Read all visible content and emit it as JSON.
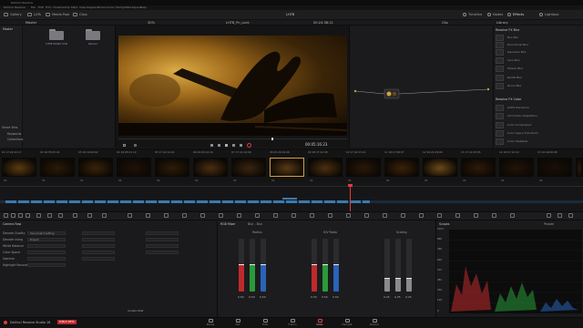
{
  "window": {
    "title": "DaVinci Resolve"
  },
  "menu": [
    "DaVinci Resolve",
    "File",
    "Edit",
    "Trim",
    "Timeline",
    "Clip",
    "Mark",
    "View",
    "Playback",
    "Fusion",
    "Color",
    "Fairlight",
    "Workspace",
    "Help"
  ],
  "toolbar": {
    "left": [
      "Gallery",
      "LUTs",
      "Media Pool",
      "Clips"
    ],
    "center": "LHTB",
    "right": [
      "Timeline",
      "Nodes",
      "Effects",
      "Lightbox"
    ]
  },
  "subbar": {
    "panel": "Master",
    "zoom": "30%",
    "clip_name": "LHTB_Pn_Lock",
    "timecode": "00:24:38:21",
    "clip_label": "Clip",
    "library": "Library"
  },
  "bins": {
    "master": "Master",
    "smart_bins": "Smart Bins",
    "items": [
      "Keywords",
      "Collections"
    ]
  },
  "media_folders": [
    "LHTB 00405 SCN",
    "Render"
  ],
  "viewer": {
    "timecode": "00:05:16:23"
  },
  "library": {
    "section1": "Resolve FX Blur",
    "items1": [
      "Box Blur",
      "Directional Blur",
      "Gaussian Blur",
      "Lens Blur",
      "Mosaic Blur",
      "Radial Blur",
      "Zoom Blur"
    ],
    "section2": "Resolve FX Color",
    "items2": [
      "ACES Transform",
      "Chromatic Adaptation",
      "Color Compressor",
      "Color Space Transform",
      "Color Stabilizer"
    ]
  },
  "clips": [
    {
      "num": "01",
      "tc": "17:22:22:17",
      "track": "V1"
    },
    {
      "num": "02",
      "tc": "16:55:05:01",
      "track": "V1"
    },
    {
      "num": "03",
      "tc": "16:19:06:02",
      "track": "V1"
    },
    {
      "num": "04",
      "tc": "19:05:01:10",
      "track": "V1"
    },
    {
      "num": "05",
      "tc": "17:41:14:01",
      "track": "V1"
    },
    {
      "num": "06",
      "tc": "20:24:22:16",
      "track": "V1"
    },
    {
      "num": "07",
      "tc": "17:41:10:06",
      "track": "V1"
    },
    {
      "num": "08",
      "tc": "20:24:29:06",
      "track": "V1"
    },
    {
      "num": "09",
      "tc": "18:37:22:08",
      "track": "V1"
    },
    {
      "num": "10",
      "tc": "17:42:13:21",
      "track": "V1"
    },
    {
      "num": "11",
      "tc": "18:17:08:07",
      "track": "V1"
    },
    {
      "num": "12",
      "tc": "20:24:29:06",
      "track": "V1"
    },
    {
      "num": "13",
      "tc": "17:11:03:05",
      "track": "V1"
    },
    {
      "num": "14",
      "tc": "18:17:12:19",
      "track": "V1"
    },
    {
      "num": "15",
      "tc": "16:49:06:08",
      "track": "V1"
    },
    {
      "num": "16",
      "tc": "20:22:23:22",
      "track": "V1"
    }
  ],
  "camera_raw": {
    "title": "Camera Raw",
    "rows": [
      {
        "label": "Decode Quality",
        "value": "Use project setting"
      },
      {
        "label": "Decode Using",
        "value": "Project"
      },
      {
        "label": "White Balance",
        "value": ""
      },
      {
        "label": "Color Space",
        "value": ""
      },
      {
        "label": "Gamma",
        "value": ""
      },
      {
        "label": "Highlight Recovery",
        "value": ""
      }
    ],
    "bottom_label": "Update RAW"
  },
  "rgb_mixer": {
    "title": "RGB Mixer",
    "mode": "Blur - Blur",
    "groups": [
      {
        "name": "Radius",
        "values": [
          "0.50",
          "0.50",
          "0.50"
        ],
        "fill": [
          0.5,
          0.5,
          0.5
        ]
      },
      {
        "name": "H/V Ratio",
        "values": [
          "0.50",
          "0.50",
          "0.50"
        ],
        "fill": [
          0.5,
          0.5,
          0.5
        ]
      },
      {
        "name": "Scaling",
        "values": [
          "0.25",
          "0.25",
          "0.25"
        ],
        "fill": [
          0.25,
          0.25,
          0.25
        ]
      }
    ]
  },
  "scopes": {
    "title": "Scopes",
    "mode": "Parade",
    "scale": [
      "1023",
      "896",
      "768",
      "640",
      "512",
      "384",
      "256",
      "128",
      "0"
    ]
  },
  "pages": [
    "Media",
    "Cut",
    "Edit",
    "Fusion",
    "Color",
    "Fairlight",
    "Deliver"
  ],
  "status": {
    "app": "DaVinci Resolve Studio 16",
    "badge": "PUBLIC BETA"
  },
  "colors": {
    "accent": "#e23b3b",
    "red": "#c0292b",
    "green": "#2a9a3a",
    "blue": "#2a63b8"
  }
}
